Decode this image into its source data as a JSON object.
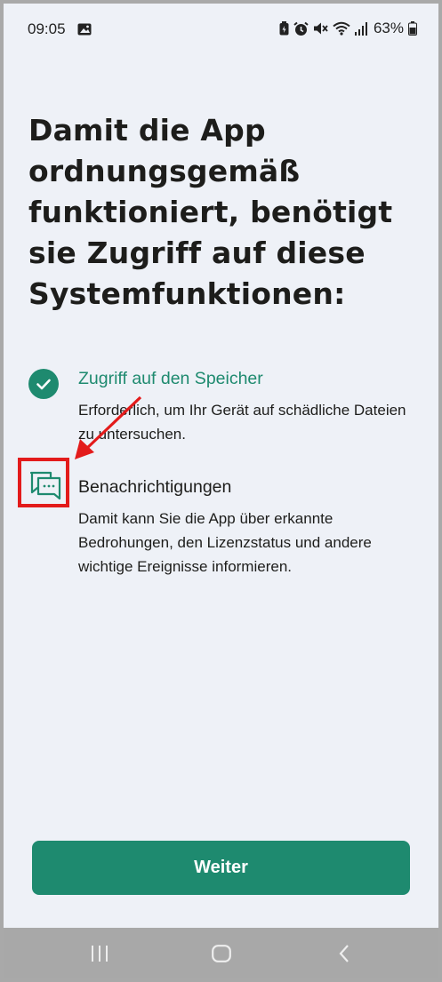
{
  "status_bar": {
    "time": "09:05",
    "battery": "63%",
    "icons": [
      "image-icon",
      "battery-saver-icon",
      "alarm-icon",
      "mute-icon",
      "wifi-icon",
      "signal-icon",
      "battery-icon"
    ]
  },
  "headline": "Damit die App ordnungsgemäß funktioniert, benötigt sie Zugriff auf diese Systemfunktionen:",
  "permissions": [
    {
      "title": "Zugriff auf den Speicher",
      "description": "Erforderlich, um Ihr Gerät auf schädliche Dateien zu untersuchen.",
      "icon": "check-circle-icon",
      "granted": true
    },
    {
      "title": "Benachrichtigungen",
      "description": "Damit kann Sie die App über erkannte Bedrohungen, den Lizenzstatus und andere wichtige Ereignisse informieren.",
      "icon": "chat-bubbles-icon",
      "granted": false
    }
  ],
  "continue_button": "Weiter",
  "nav": {
    "icons": [
      "recent-apps-icon",
      "home-icon",
      "back-icon"
    ]
  },
  "colors": {
    "accent": "#1e8a6f",
    "background": "#eef1f7",
    "annotation": "#e31b1b",
    "text": "#1d1d1b"
  }
}
